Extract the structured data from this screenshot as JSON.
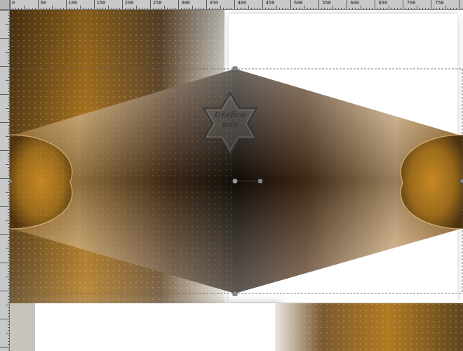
{
  "ruler": {
    "top_labels": [
      "0",
      "50",
      "100",
      "150",
      "200",
      "250",
      "300",
      "350",
      "400",
      "450",
      "500",
      "550",
      "600",
      "650",
      "700",
      "750"
    ]
  },
  "watermark": {
    "line1": "Grafica",
    "line2": "mia",
    "shape": "star-icon"
  },
  "colors": {
    "gold_dark": "#5a3a10",
    "gold": "#b87a1a",
    "gold_light": "#e8c890",
    "shadow": "#1a120a",
    "guide": "#555555",
    "ruler_bg": "#c9c9c9"
  },
  "icons": {
    "rotation_handle": "rotation-handle-icon",
    "selection_nodes": "selection-node-icon"
  }
}
